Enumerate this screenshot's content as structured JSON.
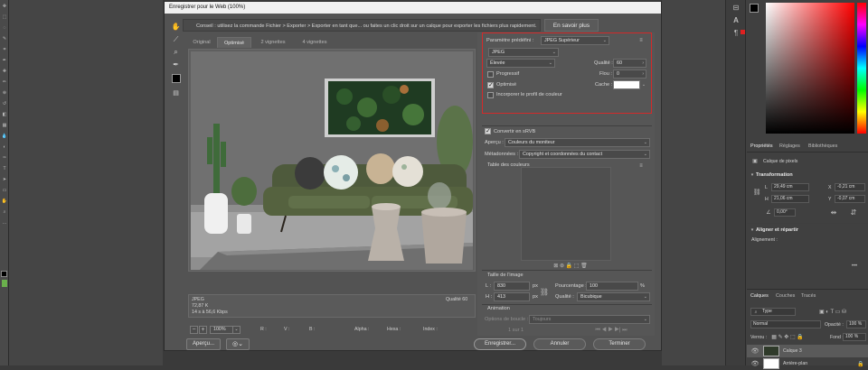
{
  "dialog": {
    "title": "Enregistrer pour le Web (100%)",
    "hint": "Conseil : utilisez la commande Fichier > Exporter > Exporter en tant que... ou faites un clic droit sur un calque pour exporter les fichiers plus rapidement.",
    "learn_more": "En savoir plus",
    "tabs": [
      "Original",
      "Optimisé",
      "2 vignettes",
      "4 vignettes"
    ],
    "active_tab": "Optimisé",
    "info": {
      "format": "JPEG",
      "size": "72,87 K",
      "time": "14 s à 56,6 Kbps",
      "quality": "Qualité 60"
    },
    "status": {
      "zoom": "100%",
      "r": "R :",
      "g": "V :",
      "b": "B :",
      "alpha": "Alpha :",
      "hexa": "Hexa :",
      "index": "Index :"
    },
    "buttons": {
      "preview": "Aperçu...",
      "save": "Enregistrer...",
      "cancel": "Annuler",
      "done": "Terminer"
    }
  },
  "settings": {
    "preset_label": "Paramètre prédéfini :",
    "preset_value": "JPEG Supérieur",
    "format": "JPEG",
    "compression": "Élevée",
    "quality_label": "Qualité :",
    "quality_value": "60",
    "progressive_label": "Progressif",
    "progressive": false,
    "blur_label": "Flou :",
    "blur_value": "0",
    "optimized_label": "Optimisé",
    "optimized": true,
    "matte_label": "Cache :",
    "embed_profile_label": "Incorporer le profil de couleur",
    "embed_profile": false,
    "convert_srgb_label": "Convertir en sRVB",
    "convert_srgb": true,
    "preview_label": "Aperçu :",
    "preview_value": "Couleurs du moniteur",
    "metadata_label": "Métadonnées :",
    "metadata_value": "Copyright et coordonnées du contact",
    "color_table_label": "Table des couleurs",
    "image_size_label": "Taille de l'image",
    "width_label": "L :",
    "width_value": "830",
    "height_label": "H :",
    "height_value": "413",
    "unit": "px",
    "percent_label": "Pourcentage :",
    "percent_value": "100",
    "percent_unit": "%",
    "resample_label": "Qualité :",
    "resample_value": "Bicubique",
    "animation_label": "Animation",
    "loop_label": "Options de boucle :",
    "loop_value": "Toujours",
    "frame_label": "1 sur 1"
  },
  "ps_panels": {
    "properties_tabs": [
      "Propriétés",
      "Réglages",
      "Bibliothèques"
    ],
    "layer_type": "Calque de pixels",
    "transform_title": "Transformation",
    "l_label": "L",
    "l_value": "29,49 cm",
    "h_label": "H",
    "h_value": "21,06 cm",
    "x_label": "X",
    "x_value": "-0,21 cm",
    "y_label": "Y",
    "y_value": "-0,07 cm",
    "angle_value": "0,00°",
    "align_title": "Aligner et répartir",
    "align_sub": "Alignement :",
    "layers_tabs": [
      "Calques",
      "Couches",
      "Tracés"
    ],
    "type_filter": "Type",
    "blend_mode": "Normal",
    "opacity_label": "Opacité :",
    "opacity_value": "100 %",
    "lock_label": "Verrou :",
    "fill_label": "Fond :",
    "fill_value": "100 %",
    "layers": [
      "Calque 3",
      "Arrière-plan"
    ]
  },
  "colors": {
    "dialog_bg": "#535353",
    "highlight_border": "#d32a2a",
    "foreground": "#000000",
    "background_swatch": "#ffffff"
  }
}
